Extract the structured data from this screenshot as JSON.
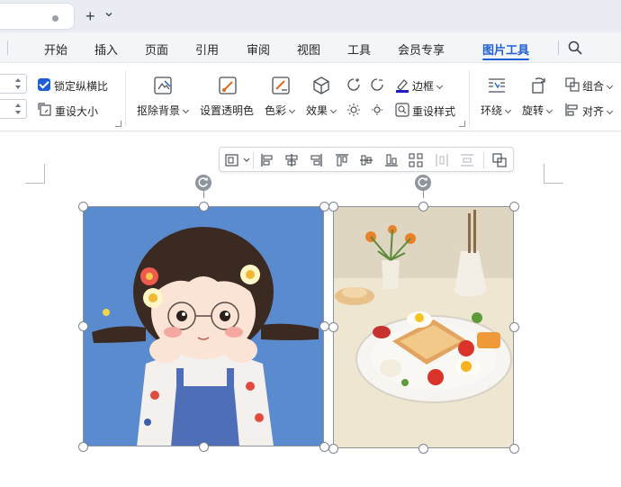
{
  "titlebar": {
    "new_tab_symbol": "+"
  },
  "menu": {
    "items": [
      "开始",
      "插入",
      "页面",
      "引用",
      "审阅",
      "视图",
      "工具",
      "会员专享",
      "图片工具"
    ],
    "active": "图片工具"
  },
  "ribbon": {
    "lock_ratio_label": "锁定纵横比",
    "lock_ratio_checked": true,
    "reset_size_label": "重设大小",
    "remove_bg_label": "抠除背景",
    "set_transparent_label": "设置透明色",
    "color_label": "色彩",
    "effects_label": "效果",
    "border_label": "边框",
    "reset_style_label": "重设样式",
    "wrap_label": "环绕",
    "rotate_label": "旋转",
    "group_label": "组合",
    "align_label": "对齐"
  },
  "icons": {
    "search": "search-icon",
    "rotate_handle": "rotate-icon"
  },
  "colors": {
    "accent": "#1f5fd6",
    "border_underline": "#1f1fbf",
    "menu_bg": "#f3f5f8",
    "title_bg": "#e9edf3"
  },
  "images": [
    {
      "subject": "cartoon girl with flowers",
      "background": "#5b8bcf"
    },
    {
      "subject": "breakfast plate with bread, eggs and tomatoes",
      "background": "#efe6d2"
    }
  ]
}
